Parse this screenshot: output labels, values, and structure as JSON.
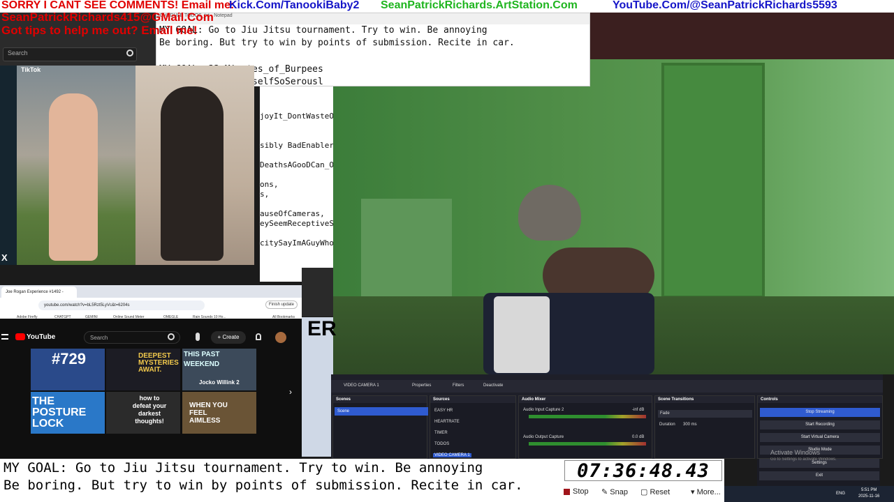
{
  "banner": {
    "line1_red": "SORRY I CANT SEE COMMENTS! Email me:",
    "kick": "Kick.Com/TanookiBaby2",
    "artstation": "SeanPatrickRichards.ArtStation.Com",
    "youtube": "YouTube.Com/@SeanPatrickRichards5593",
    "line2": "SeanPatrickRichards415@GMail.Com",
    "line3": "Got tips to help me out? Email me!"
  },
  "left_search": {
    "placeholder": "Search"
  },
  "notepad": {
    "title": "SCHEDULE TODOS_txt - Notepad",
    "line1": "MY GOAL: Go to Jiu Jitsu tournament. Try to win. Be annoying",
    "line2": "Be boring. But try to win by points of submission. Recite in car.",
    "line3": "MY GOAL: 33_Minutes_of_Burpees",
    "line4": "RelaxDontTakeYourselfSoSerousl",
    "col_lines": [
      "joyIt_DontWasteO",
      "",
      "",
      "sibly BadEnabler)",
      "",
      "DeathsAGooDCan_O",
      "",
      "ons,",
      "s,",
      "",
      "auseOfCameras,",
      "eySeemReceptiveS",
      "",
      "citySayImAGuyWho"
    ]
  },
  "tiktok": {
    "logo": "TikTok",
    "close": "X"
  },
  "chrome": {
    "tab": "Joe Rogan Experience #1492 -",
    "url": "youtube.com/watch?v=bL5Rzt5LyVc&t=6204s",
    "finish_update": "Finish update",
    "bookmarks": [
      "Adobe Firefly",
      "CHATGPT",
      "GEMINI",
      "Online Sound Meter",
      "OMEGLE",
      "Rain Sounds 10 Ho...",
      "All Bookmarks"
    ],
    "yt_logo": "YouTube",
    "search_placeholder": "Search",
    "create": "+ Create",
    "thumbs": [
      "#729",
      "DEEPEST MYSTERIES AWAIT.",
      "THIS PAST WEEKEND",
      "Jocko Willink 2",
      "THE POSTURE LOCK",
      "how to defeat your darkest thoughts!",
      "WHEN YOU FEEL AIMLESS"
    ]
  },
  "obs": {
    "source_name": "VIDEO CAMERA 1",
    "properties": "Properties",
    "filters": "Filters",
    "deactivate": "Deactivate",
    "scenes_title": "Scenes",
    "scene": "Scene",
    "sources_title": "Sources",
    "sources": [
      "EASY HR",
      "HEARTRATE",
      "TIMER",
      "TODOS",
      "VIDEO CAMERA 1"
    ],
    "mixer_title": "Audio Mixer",
    "mixer": [
      {
        "name": "Audio Input Capture 2",
        "db": "-inf dB"
      },
      {
        "name": "Audio Output Capture",
        "db": "0.0 dB"
      }
    ],
    "transitions_title": "Scene Transitions",
    "transition": "Fade",
    "duration_label": "Duration",
    "duration": "300 ms",
    "controls_title": "Controls",
    "controls": [
      "Stop Streaming",
      "Start Recording",
      "Start Virtual Camera",
      "Studio Mode",
      "Settings",
      "Exit"
    ]
  },
  "goal": {
    "line1": "MY GOAL: Go to Jiu Jitsu tournament. Try to win. Be annoying",
    "line2": "Be boring. But try to win by points of submission. Recite in car."
  },
  "timer": {
    "value": "07:36:48.43",
    "stop": "Stop",
    "snap": "Snap",
    "reset": "Reset",
    "more": "More..."
  },
  "taskbar": {
    "lang": "ENG",
    "time": "5:51 PM",
    "date": "2025-11-16"
  },
  "windows_watermark": {
    "line1": "Activate Windows",
    "line2": "Go to Settings to activate Windows."
  }
}
